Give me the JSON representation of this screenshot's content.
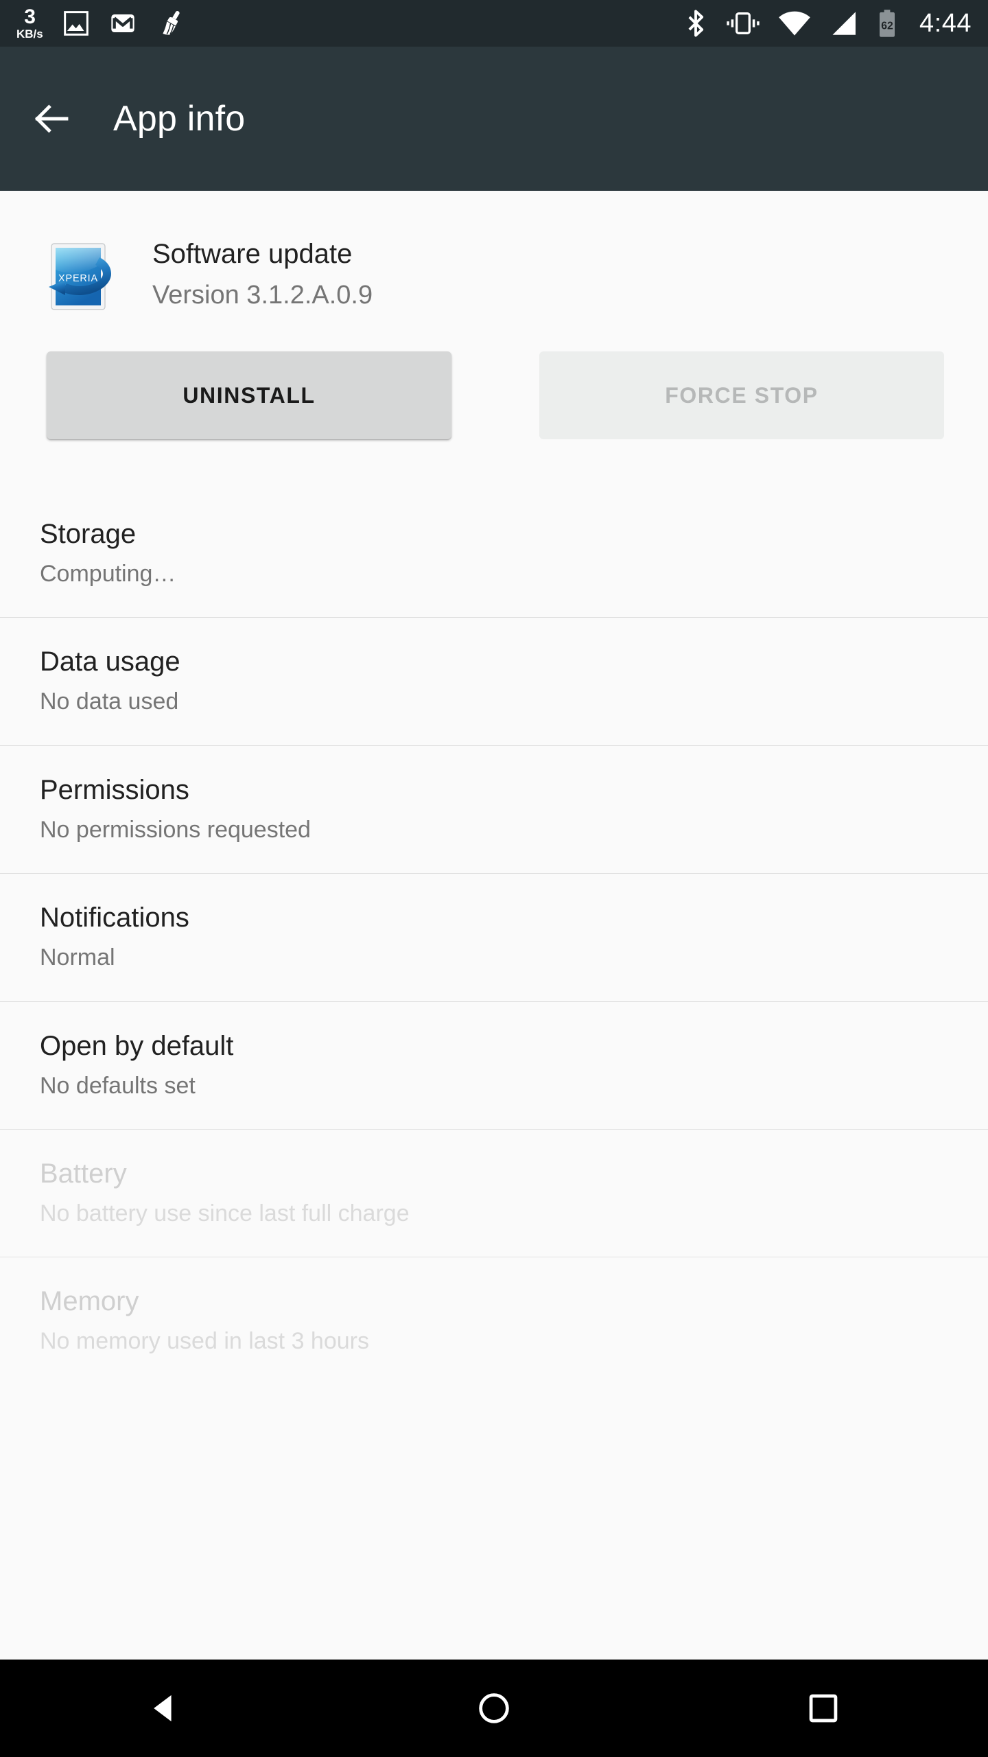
{
  "statusbar": {
    "network_speed_value": "3",
    "network_speed_unit": "KB/s",
    "icons": [
      "photos-icon",
      "gmail-icon",
      "cleaner-broom-icon",
      "bluetooth-icon",
      "vibrate-icon",
      "wifi-icon",
      "cellular-signal-icon"
    ],
    "battery_level": "62",
    "time": "4:44"
  },
  "appbar": {
    "back_label": "back-arrow",
    "title": "App info"
  },
  "app": {
    "icon_label": "XPERIA",
    "name": "Software update",
    "version": "Version 3.1.2.A.0.9"
  },
  "actions": {
    "uninstall_label": "UNINSTALL",
    "force_stop_label": "FORCE STOP"
  },
  "rows": [
    {
      "title": "Storage",
      "subtitle": "Computing…",
      "disabled": false
    },
    {
      "title": "Data usage",
      "subtitle": "No data used",
      "disabled": false
    },
    {
      "title": "Permissions",
      "subtitle": "No permissions requested",
      "disabled": false
    },
    {
      "title": "Notifications",
      "subtitle": "Normal",
      "disabled": false
    },
    {
      "title": "Open by default",
      "subtitle": "No defaults set",
      "disabled": false
    },
    {
      "title": "Battery",
      "subtitle": "No battery use since last full charge",
      "disabled": true
    },
    {
      "title": "Memory",
      "subtitle": "No memory used in last 3 hours",
      "disabled": true
    }
  ],
  "navbar": {
    "back": "nav-back-triangle",
    "home": "nav-home-circle",
    "recents": "nav-recents-square"
  },
  "colors": {
    "statusbar_bg": "#212a2e",
    "appbar_bg": "#2c383d",
    "page_bg": "#fafafa",
    "primary_text": "#212121",
    "secondary_text": "#757575",
    "divider": "#dcdcdc",
    "button_enabled_bg": "#d6d7d7",
    "button_disabled_bg": "#eceeed",
    "navbar_bg": "#000000",
    "accent_blue": "#2196c4"
  }
}
